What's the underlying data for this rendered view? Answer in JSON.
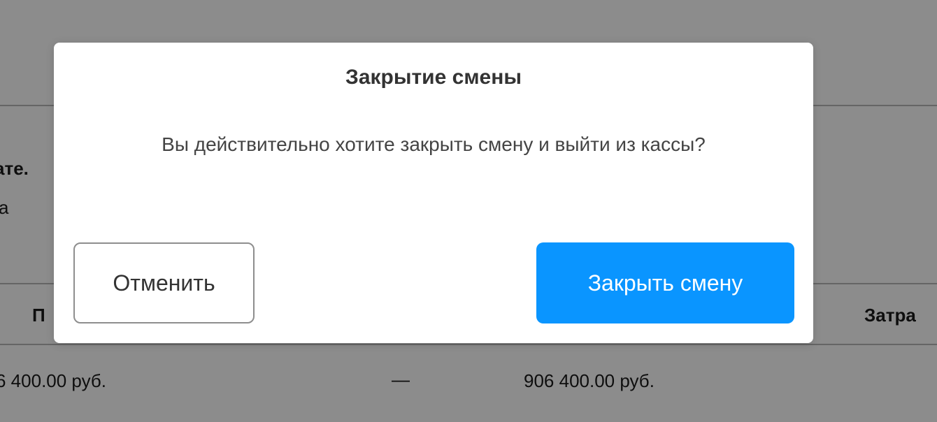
{
  "background": {
    "label_bold": "ате.",
    "label_plain": "а",
    "column_left": "П",
    "column_right": "Затра",
    "amount_left": "6 400.00 руб.",
    "dash": "—",
    "amount_right": "906 400.00 руб."
  },
  "dialog": {
    "title": "Закрытие смены",
    "message": "Вы действительно хотите закрыть смену и выйти из кассы?",
    "cancel_label": "Отменить",
    "confirm_label": "Закрыть смену"
  },
  "colors": {
    "confirm_button": "#0a95ff",
    "overlay": "rgba(0,0,0,0.45)"
  }
}
